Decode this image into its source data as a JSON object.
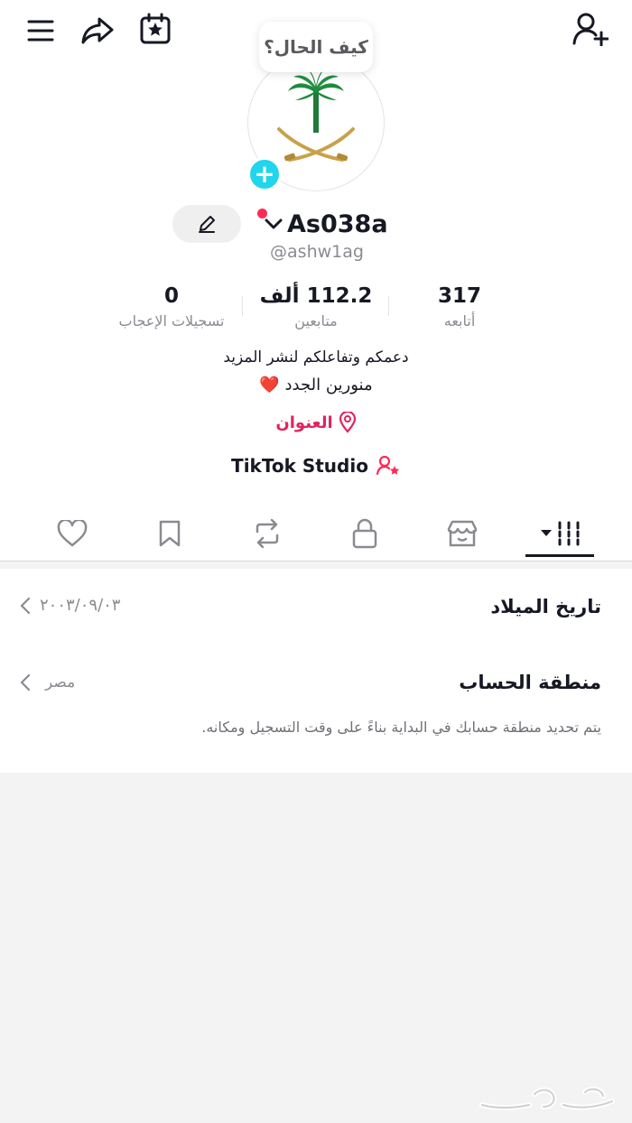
{
  "profile": {
    "bubble_text": "كيف الحال؟",
    "display_name": "As038a",
    "username": "@ashw1ag",
    "stats": {
      "following": {
        "value": "317",
        "label": "أتابعه"
      },
      "followers": {
        "value": "112.2 ألف",
        "label": "متابعين"
      },
      "likes": {
        "value": "0",
        "label": "تسجيلات الإعجاب"
      }
    },
    "bio_line1": "دعمكم وتفاعلكم لنشر المزيد",
    "bio_line2": "منورين الجدد ❤️",
    "location": "العنوان",
    "studio": "TikTok Studio"
  },
  "tabs": [
    "videos-grid",
    "shop",
    "private",
    "reposts",
    "favorites",
    "liked"
  ],
  "settings": {
    "birthday_title": "تاريخ الميلاد",
    "birthday_value": "٢٠٠٣/٠٩/٠٣",
    "region_title": "منطقة الحساب",
    "region_value": "مصر",
    "region_desc": "يتم تحديد منطقة حسابك في البداية بناءً على وقت التسجيل ومكانه."
  },
  "colors": {
    "accent_red": "#fe2c55",
    "badge_cyan": "#20d5ec",
    "text_primary": "#161823",
    "text_secondary": "#8a8b91"
  }
}
